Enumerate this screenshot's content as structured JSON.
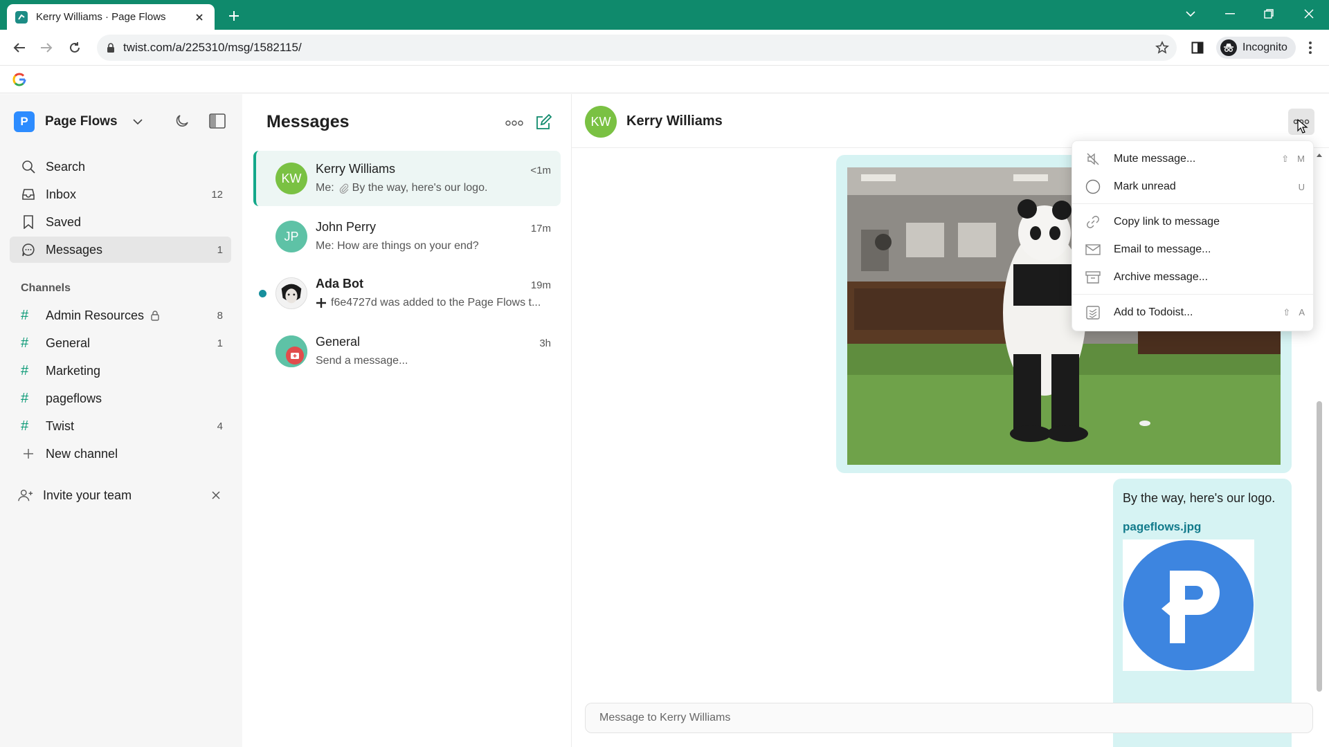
{
  "browser": {
    "tab_title": "Kerry Williams · Page Flows",
    "url": "twist.com/a/225310/msg/1582115/",
    "incognito_label": "Incognito"
  },
  "sidebar": {
    "workspace_name": "Page Flows",
    "workspace_initial": "P",
    "nav": [
      {
        "label": "Search",
        "icon": "search-icon",
        "count": ""
      },
      {
        "label": "Inbox",
        "icon": "inbox-icon",
        "count": "12"
      },
      {
        "label": "Saved",
        "icon": "bookmark-icon",
        "count": ""
      },
      {
        "label": "Messages",
        "icon": "chat-bubble-icon",
        "count": "1"
      }
    ],
    "channels_heading": "Channels",
    "channels": [
      {
        "label": "Admin Resources",
        "count": "8",
        "locked": true
      },
      {
        "label": "General",
        "count": "1"
      },
      {
        "label": "Marketing",
        "count": ""
      },
      {
        "label": "pageflows",
        "count": ""
      },
      {
        "label": "Twist",
        "count": "4"
      }
    ],
    "new_channel_label": "New channel",
    "invite_label": "Invite your team"
  },
  "message_list": {
    "title": "Messages",
    "conversations": [
      {
        "name": "Kerry Williams",
        "initials": "KW",
        "time": "<1m",
        "preview_prefix": "Me:",
        "preview": "By the way, here's our logo.",
        "avatar_color": "#7ac143",
        "active": true
      },
      {
        "name": "John Perry",
        "initials": "JP",
        "time": "17m",
        "preview": "Me: How are things on your end?",
        "avatar_color": "#5ec2a6"
      },
      {
        "name": "Ada Bot",
        "initials": "",
        "time": "19m",
        "preview": "f6e4727d was added to the Page Flows t...",
        "unread": true
      },
      {
        "name": "General",
        "initials": "",
        "time": "3h",
        "preview": "Send a message..."
      }
    ]
  },
  "conversation": {
    "header_name": "Kerry Williams",
    "header_initials": "KW",
    "message_text": "By the way, here's our logo.",
    "attachment_name": "pageflows.jpg",
    "composer_placeholder": "Message to Kerry Williams"
  },
  "context_menu": {
    "items": [
      {
        "label": "Mute message...",
        "icon": "mute-icon",
        "shortcut": [
          "⇧",
          "M"
        ]
      },
      {
        "label": "Mark unread",
        "icon": "circle-icon",
        "shortcut": [
          "U"
        ]
      },
      {
        "label": "Copy link to message",
        "icon": "link-icon",
        "shortcut": []
      },
      {
        "label": "Email to message...",
        "icon": "envelope-icon",
        "shortcut": []
      },
      {
        "label": "Archive message...",
        "icon": "archive-icon",
        "shortcut": []
      },
      {
        "label": "Add to Todoist...",
        "icon": "todoist-icon",
        "shortcut": [
          "⇧",
          "A"
        ]
      }
    ]
  },
  "colors": {
    "accent_green": "#0f8a6c",
    "channel_hash": "#0e9b78",
    "bubble": "#d6f3f3",
    "link": "#117a8b"
  }
}
